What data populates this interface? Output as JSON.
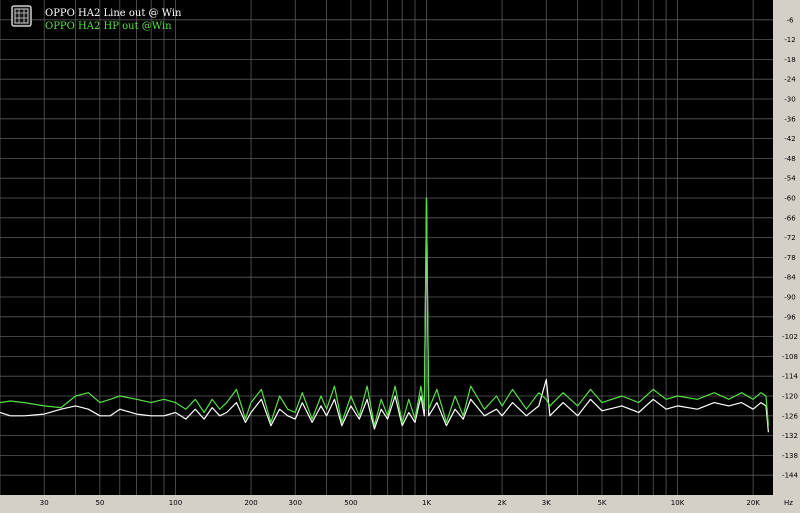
{
  "chart_data": {
    "type": "line",
    "title": "",
    "xlabel": "",
    "ylabel": "",
    "x_unit": "Hz",
    "x_scale": "log",
    "xlim": [
      20,
      24000
    ],
    "ylim": [
      -150,
      0
    ],
    "grid": true,
    "legend_position": "top-left",
    "colors": {
      "background": "#000000",
      "grid": "#5a5a5a",
      "frame": "#d4d0c8"
    },
    "x_ticks": [
      {
        "value": 30,
        "label": "30"
      },
      {
        "value": 50,
        "label": "50"
      },
      {
        "value": 100,
        "label": "100"
      },
      {
        "value": 200,
        "label": "200"
      },
      {
        "value": 300,
        "label": "300"
      },
      {
        "value": 500,
        "label": "500"
      },
      {
        "value": 1000,
        "label": "1K"
      },
      {
        "value": 2000,
        "label": "2K"
      },
      {
        "value": 3000,
        "label": "3K"
      },
      {
        "value": 5000,
        "label": "5K"
      },
      {
        "value": 10000,
        "label": "10K"
      },
      {
        "value": 20000,
        "label": "20K"
      }
    ],
    "x_minor_grid": [
      20,
      40,
      60,
      70,
      80,
      90,
      400,
      600,
      700,
      800,
      900,
      4000,
      6000,
      7000,
      8000,
      9000
    ],
    "y_ticks": [
      {
        "value": -6,
        "label": "-6"
      },
      {
        "value": -12,
        "label": "-12"
      },
      {
        "value": -18,
        "label": "-18"
      },
      {
        "value": -24,
        "label": "-24"
      },
      {
        "value": -30,
        "label": "-30"
      },
      {
        "value": -36,
        "label": "-36"
      },
      {
        "value": -42,
        "label": "-42"
      },
      {
        "value": -48,
        "label": "-48"
      },
      {
        "value": -54,
        "label": "-54"
      },
      {
        "value": -60,
        "label": "-60"
      },
      {
        "value": -66,
        "label": "-66"
      },
      {
        "value": -72,
        "label": "-72"
      },
      {
        "value": -78,
        "label": "-78"
      },
      {
        "value": -84,
        "label": "-84"
      },
      {
        "value": -90,
        "label": "-90"
      },
      {
        "value": -96,
        "label": "-96"
      },
      {
        "value": -102,
        "label": "-102"
      },
      {
        "value": -108,
        "label": "-108"
      },
      {
        "value": -114,
        "label": "-114"
      },
      {
        "value": -120,
        "label": "-120"
      },
      {
        "value": -126,
        "label": "-126"
      },
      {
        "value": -132,
        "label": "-132"
      },
      {
        "value": -138,
        "label": "-138"
      },
      {
        "value": -144,
        "label": "-144"
      }
    ],
    "series": [
      {
        "name": "OPPO HA2 Line out @ Win",
        "color": "#ffffff",
        "points": [
          [
            20,
            -125
          ],
          [
            22,
            -126
          ],
          [
            25,
            -126
          ],
          [
            30,
            -125.5
          ],
          [
            35,
            -124
          ],
          [
            40,
            -123
          ],
          [
            45,
            -124
          ],
          [
            50,
            -126
          ],
          [
            55,
            -126
          ],
          [
            60,
            -124
          ],
          [
            70,
            -125.5
          ],
          [
            80,
            -126
          ],
          [
            90,
            -126
          ],
          [
            100,
            -125
          ],
          [
            110,
            -127
          ],
          [
            120,
            -124
          ],
          [
            130,
            -127
          ],
          [
            140,
            -123.5
          ],
          [
            150,
            -126
          ],
          [
            160,
            -125
          ],
          [
            175,
            -122
          ],
          [
            190,
            -128
          ],
          [
            200,
            -125
          ],
          [
            220,
            -121
          ],
          [
            240,
            -129
          ],
          [
            260,
            -124
          ],
          [
            280,
            -126
          ],
          [
            300,
            -127
          ],
          [
            320,
            -122
          ],
          [
            350,
            -128
          ],
          [
            380,
            -123
          ],
          [
            400,
            -126
          ],
          [
            430,
            -121
          ],
          [
            460,
            -129
          ],
          [
            500,
            -123
          ],
          [
            540,
            -127
          ],
          [
            580,
            -121
          ],
          [
            620,
            -130
          ],
          [
            660,
            -124
          ],
          [
            700,
            -127
          ],
          [
            750,
            -120
          ],
          [
            800,
            -129
          ],
          [
            850,
            -125
          ],
          [
            900,
            -128
          ],
          [
            950,
            -120
          ],
          [
            980,
            -126
          ],
          [
            1000,
            -60
          ],
          [
            1020,
            -126
          ],
          [
            1100,
            -122
          ],
          [
            1200,
            -129
          ],
          [
            1300,
            -124
          ],
          [
            1400,
            -127
          ],
          [
            1500,
            -121
          ],
          [
            1700,
            -126
          ],
          [
            1900,
            -124
          ],
          [
            2000,
            -126
          ],
          [
            2200,
            -122
          ],
          [
            2500,
            -126
          ],
          [
            2800,
            -123
          ],
          [
            3000,
            -115
          ],
          [
            3100,
            -126
          ],
          [
            3500,
            -122
          ],
          [
            4000,
            -126
          ],
          [
            4500,
            -121
          ],
          [
            5000,
            -124.5
          ],
          [
            6000,
            -123
          ],
          [
            7000,
            -125
          ],
          [
            8000,
            -121
          ],
          [
            9000,
            -124
          ],
          [
            10000,
            -123
          ],
          [
            12000,
            -124
          ],
          [
            14000,
            -122
          ],
          [
            16000,
            -123
          ],
          [
            18000,
            -122
          ],
          [
            20000,
            -124
          ],
          [
            21500,
            -122
          ],
          [
            22500,
            -123
          ],
          [
            23000,
            -131
          ]
        ]
      },
      {
        "name": "OPPO HA2 HP out @Win",
        "color": "#55e045",
        "points": [
          [
            20,
            -122
          ],
          [
            22,
            -121.5
          ],
          [
            25,
            -122
          ],
          [
            30,
            -123
          ],
          [
            35,
            -123.5
          ],
          [
            40,
            -120
          ],
          [
            45,
            -119
          ],
          [
            50,
            -122
          ],
          [
            55,
            -121
          ],
          [
            60,
            -120
          ],
          [
            70,
            -121
          ],
          [
            80,
            -122
          ],
          [
            90,
            -121
          ],
          [
            100,
            -122
          ],
          [
            110,
            -124
          ],
          [
            120,
            -121
          ],
          [
            130,
            -125
          ],
          [
            140,
            -121
          ],
          [
            150,
            -124
          ],
          [
            160,
            -122
          ],
          [
            175,
            -118
          ],
          [
            190,
            -127
          ],
          [
            200,
            -122
          ],
          [
            220,
            -118
          ],
          [
            240,
            -128
          ],
          [
            260,
            -120
          ],
          [
            280,
            -124
          ],
          [
            300,
            -125
          ],
          [
            320,
            -119
          ],
          [
            350,
            -127
          ],
          [
            380,
            -120
          ],
          [
            400,
            -124
          ],
          [
            430,
            -117
          ],
          [
            460,
            -128
          ],
          [
            500,
            -120
          ],
          [
            540,
            -126
          ],
          [
            580,
            -117
          ],
          [
            620,
            -129
          ],
          [
            660,
            -121
          ],
          [
            700,
            -126
          ],
          [
            750,
            -117
          ],
          [
            800,
            -128
          ],
          [
            850,
            -121
          ],
          [
            900,
            -127
          ],
          [
            950,
            -117
          ],
          [
            980,
            -124
          ],
          [
            1000,
            -60
          ],
          [
            1020,
            -124
          ],
          [
            1100,
            -118
          ],
          [
            1200,
            -128
          ],
          [
            1300,
            -120
          ],
          [
            1400,
            -126
          ],
          [
            1500,
            -117
          ],
          [
            1700,
            -124
          ],
          [
            1900,
            -120
          ],
          [
            2000,
            -123
          ],
          [
            2200,
            -118
          ],
          [
            2500,
            -124
          ],
          [
            2800,
            -119
          ],
          [
            3000,
            -121
          ],
          [
            3100,
            -123
          ],
          [
            3500,
            -119
          ],
          [
            4000,
            -123
          ],
          [
            4500,
            -118
          ],
          [
            5000,
            -122
          ],
          [
            6000,
            -120
          ],
          [
            7000,
            -122
          ],
          [
            8000,
            -118
          ],
          [
            9000,
            -121
          ],
          [
            10000,
            -120
          ],
          [
            12000,
            -121
          ],
          [
            14000,
            -119
          ],
          [
            16000,
            -121
          ],
          [
            18000,
            -119
          ],
          [
            20000,
            -121
          ],
          [
            21500,
            -119
          ],
          [
            22500,
            -120
          ],
          [
            23000,
            -129
          ]
        ]
      }
    ]
  }
}
